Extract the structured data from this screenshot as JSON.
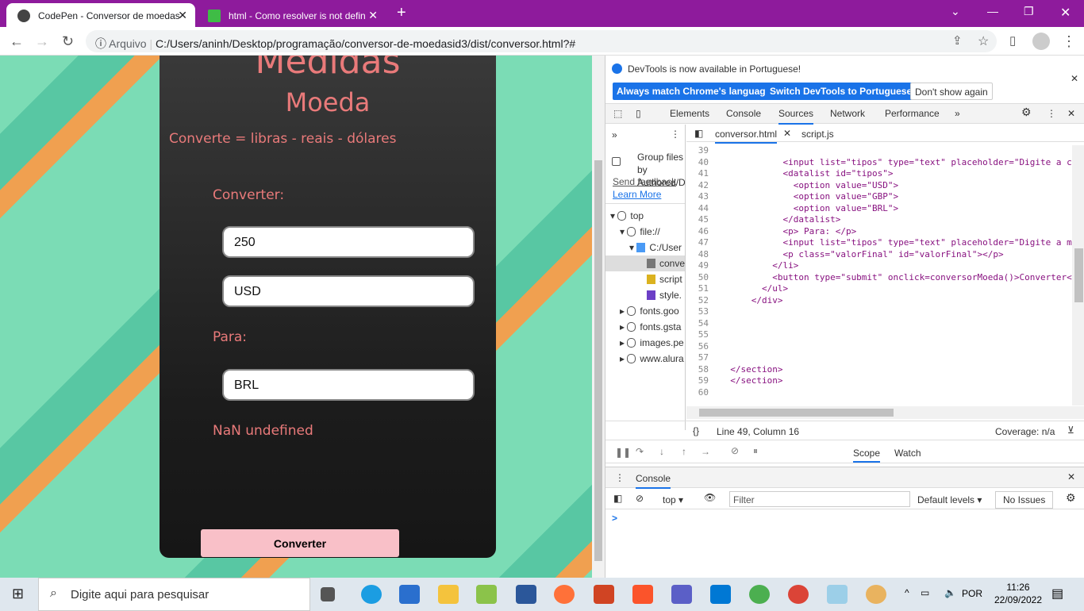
{
  "browser": {
    "tabs": [
      {
        "title": "CodePen - Conversor de moedas",
        "active": true
      },
      {
        "title": "html - Como resolver is not defin",
        "active": false
      }
    ],
    "address_prefix": "Arquivo",
    "url": "C:/Users/aninh/Desktop/programação/conversor-de-moedasid3/dist/conversor.html?#"
  },
  "page": {
    "title": "Medidas",
    "subtitle": "Moeda",
    "description": "Converte = libras - reais - dólares",
    "label_from": "Converter:",
    "amount": "250",
    "from_currency": "USD",
    "label_to": "Para:",
    "to_currency": "BRL",
    "result": "NaN undefined",
    "button": "Converter"
  },
  "devtools": {
    "infobar": {
      "message": "DevTools is now available in Portuguese!",
      "btn1": "Always match Chrome's language",
      "btn2": "Switch DevTools to Portuguese",
      "btn3": "Don't show again"
    },
    "tabs": [
      "Elements",
      "Console",
      "Sources",
      "Network",
      "Performance"
    ],
    "active_tab": "Sources",
    "nav": {
      "group_label": "Group files by Authored/D",
      "send_feedback": "Send feedback",
      "learn_more": "Learn More",
      "tree": [
        {
          "label": "top",
          "depth": 0
        },
        {
          "label": "file://",
          "depth": 1
        },
        {
          "label": "C:/User",
          "depth": 2
        },
        {
          "label": "conve",
          "depth": 3,
          "selected": true,
          "color": "#777777"
        },
        {
          "label": "script",
          "depth": 3,
          "color": "#dbb21f"
        },
        {
          "label": "style.",
          "depth": 3,
          "color": "#6c3fc6"
        },
        {
          "label": "fonts.goo",
          "depth": 1
        },
        {
          "label": "fonts.gsta",
          "depth": 1
        },
        {
          "label": "images.pe",
          "depth": 1
        },
        {
          "label": "www.alura",
          "depth": 1
        }
      ]
    },
    "files": [
      "conversor.html",
      "script.js"
    ],
    "code": [
      {
        "n": "39",
        "t": ""
      },
      {
        "n": "40",
        "t": "            <input list=\"tipos\" type=\"text\" placeholder=\"Digite a c"
      },
      {
        "n": "41",
        "t": "            <datalist id=\"tipos\">"
      },
      {
        "n": "42",
        "t": "              <option value=\"USD\">"
      },
      {
        "n": "43",
        "t": "              <option value=\"GBP\">"
      },
      {
        "n": "44",
        "t": "              <option value=\"BRL\">"
      },
      {
        "n": "45",
        "t": "            </datalist>"
      },
      {
        "n": "46",
        "t": "            <p> Para: </p>"
      },
      {
        "n": "47",
        "t": "            <input list=\"tipos\" type=\"text\" placeholder=\"Digite a m"
      },
      {
        "n": "48",
        "t": "            <p class=\"valorFinal\" id=\"valorFinal\"></p>"
      },
      {
        "n": "49",
        "t": "          </li>"
      },
      {
        "n": "50",
        "t": "          <button type=\"submit\" onclick=conversorMoeda()>Converter<"
      },
      {
        "n": "51",
        "t": "        </ul>"
      },
      {
        "n": "52",
        "t": "      </div>"
      },
      {
        "n": "53",
        "t": ""
      },
      {
        "n": "54",
        "t": ""
      },
      {
        "n": "55",
        "t": ""
      },
      {
        "n": "56",
        "t": ""
      },
      {
        "n": "57",
        "t": ""
      },
      {
        "n": "58",
        "t": "  </section>"
      },
      {
        "n": "59",
        "t": "  </section>"
      },
      {
        "n": "60",
        "t": ""
      }
    ],
    "status": {
      "position": "Line 49, Column 16",
      "coverage": "Coverage: n/a"
    },
    "debug_tabs": [
      "Scope",
      "Watch"
    ],
    "console": {
      "title": "Console",
      "context": "top",
      "filter_placeholder": "Filter",
      "levels": "Default levels",
      "issues": "No Issues",
      "prompt": ">"
    }
  },
  "taskbar": {
    "search_placeholder": "Digite aqui para pesquisar",
    "lang": "POR",
    "time": "11:26",
    "date": "22/09/2022"
  }
}
